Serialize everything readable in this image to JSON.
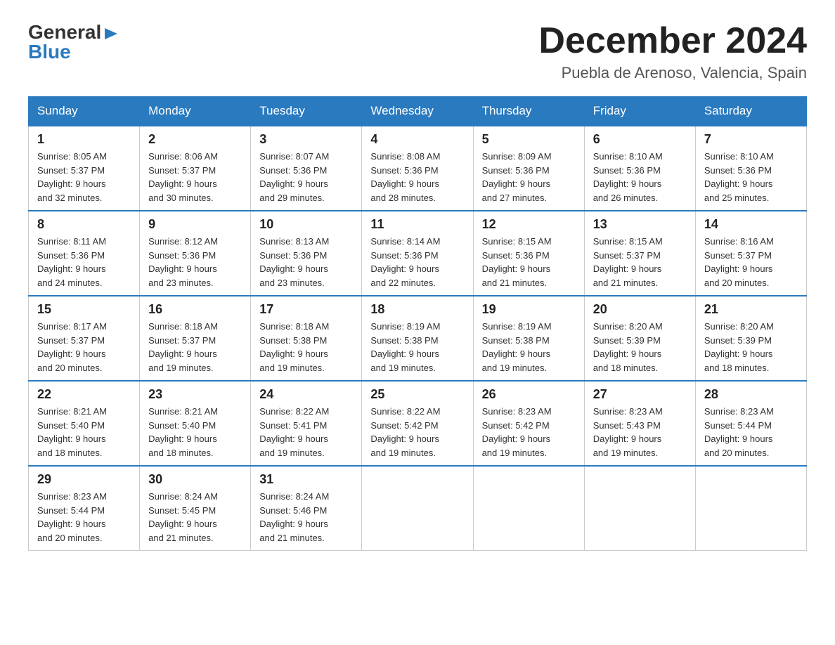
{
  "header": {
    "logo_general": "General",
    "logo_blue": "Blue",
    "month_year": "December 2024",
    "location": "Puebla de Arenoso, Valencia, Spain"
  },
  "days_of_week": [
    "Sunday",
    "Monday",
    "Tuesday",
    "Wednesday",
    "Thursday",
    "Friday",
    "Saturday"
  ],
  "weeks": [
    [
      {
        "day": "1",
        "sunrise": "8:05 AM",
        "sunset": "5:37 PM",
        "daylight": "9 hours and 32 minutes."
      },
      {
        "day": "2",
        "sunrise": "8:06 AM",
        "sunset": "5:37 PM",
        "daylight": "9 hours and 30 minutes."
      },
      {
        "day": "3",
        "sunrise": "8:07 AM",
        "sunset": "5:36 PM",
        "daylight": "9 hours and 29 minutes."
      },
      {
        "day": "4",
        "sunrise": "8:08 AM",
        "sunset": "5:36 PM",
        "daylight": "9 hours and 28 minutes."
      },
      {
        "day": "5",
        "sunrise": "8:09 AM",
        "sunset": "5:36 PM",
        "daylight": "9 hours and 27 minutes."
      },
      {
        "day": "6",
        "sunrise": "8:10 AM",
        "sunset": "5:36 PM",
        "daylight": "9 hours and 26 minutes."
      },
      {
        "day": "7",
        "sunrise": "8:10 AM",
        "sunset": "5:36 PM",
        "daylight": "9 hours and 25 minutes."
      }
    ],
    [
      {
        "day": "8",
        "sunrise": "8:11 AM",
        "sunset": "5:36 PM",
        "daylight": "9 hours and 24 minutes."
      },
      {
        "day": "9",
        "sunrise": "8:12 AM",
        "sunset": "5:36 PM",
        "daylight": "9 hours and 23 minutes."
      },
      {
        "day": "10",
        "sunrise": "8:13 AM",
        "sunset": "5:36 PM",
        "daylight": "9 hours and 23 minutes."
      },
      {
        "day": "11",
        "sunrise": "8:14 AM",
        "sunset": "5:36 PM",
        "daylight": "9 hours and 22 minutes."
      },
      {
        "day": "12",
        "sunrise": "8:15 AM",
        "sunset": "5:36 PM",
        "daylight": "9 hours and 21 minutes."
      },
      {
        "day": "13",
        "sunrise": "8:15 AM",
        "sunset": "5:37 PM",
        "daylight": "9 hours and 21 minutes."
      },
      {
        "day": "14",
        "sunrise": "8:16 AM",
        "sunset": "5:37 PM",
        "daylight": "9 hours and 20 minutes."
      }
    ],
    [
      {
        "day": "15",
        "sunrise": "8:17 AM",
        "sunset": "5:37 PM",
        "daylight": "9 hours and 20 minutes."
      },
      {
        "day": "16",
        "sunrise": "8:18 AM",
        "sunset": "5:37 PM",
        "daylight": "9 hours and 19 minutes."
      },
      {
        "day": "17",
        "sunrise": "8:18 AM",
        "sunset": "5:38 PM",
        "daylight": "9 hours and 19 minutes."
      },
      {
        "day": "18",
        "sunrise": "8:19 AM",
        "sunset": "5:38 PM",
        "daylight": "9 hours and 19 minutes."
      },
      {
        "day": "19",
        "sunrise": "8:19 AM",
        "sunset": "5:38 PM",
        "daylight": "9 hours and 19 minutes."
      },
      {
        "day": "20",
        "sunrise": "8:20 AM",
        "sunset": "5:39 PM",
        "daylight": "9 hours and 18 minutes."
      },
      {
        "day": "21",
        "sunrise": "8:20 AM",
        "sunset": "5:39 PM",
        "daylight": "9 hours and 18 minutes."
      }
    ],
    [
      {
        "day": "22",
        "sunrise": "8:21 AM",
        "sunset": "5:40 PM",
        "daylight": "9 hours and 18 minutes."
      },
      {
        "day": "23",
        "sunrise": "8:21 AM",
        "sunset": "5:40 PM",
        "daylight": "9 hours and 18 minutes."
      },
      {
        "day": "24",
        "sunrise": "8:22 AM",
        "sunset": "5:41 PM",
        "daylight": "9 hours and 19 minutes."
      },
      {
        "day": "25",
        "sunrise": "8:22 AM",
        "sunset": "5:42 PM",
        "daylight": "9 hours and 19 minutes."
      },
      {
        "day": "26",
        "sunrise": "8:23 AM",
        "sunset": "5:42 PM",
        "daylight": "9 hours and 19 minutes."
      },
      {
        "day": "27",
        "sunrise": "8:23 AM",
        "sunset": "5:43 PM",
        "daylight": "9 hours and 19 minutes."
      },
      {
        "day": "28",
        "sunrise": "8:23 AM",
        "sunset": "5:44 PM",
        "daylight": "9 hours and 20 minutes."
      }
    ],
    [
      {
        "day": "29",
        "sunrise": "8:23 AM",
        "sunset": "5:44 PM",
        "daylight": "9 hours and 20 minutes."
      },
      {
        "day": "30",
        "sunrise": "8:24 AM",
        "sunset": "5:45 PM",
        "daylight": "9 hours and 21 minutes."
      },
      {
        "day": "31",
        "sunrise": "8:24 AM",
        "sunset": "5:46 PM",
        "daylight": "9 hours and 21 minutes."
      },
      null,
      null,
      null,
      null
    ]
  ],
  "labels": {
    "sunrise": "Sunrise:",
    "sunset": "Sunset:",
    "daylight": "Daylight:"
  }
}
